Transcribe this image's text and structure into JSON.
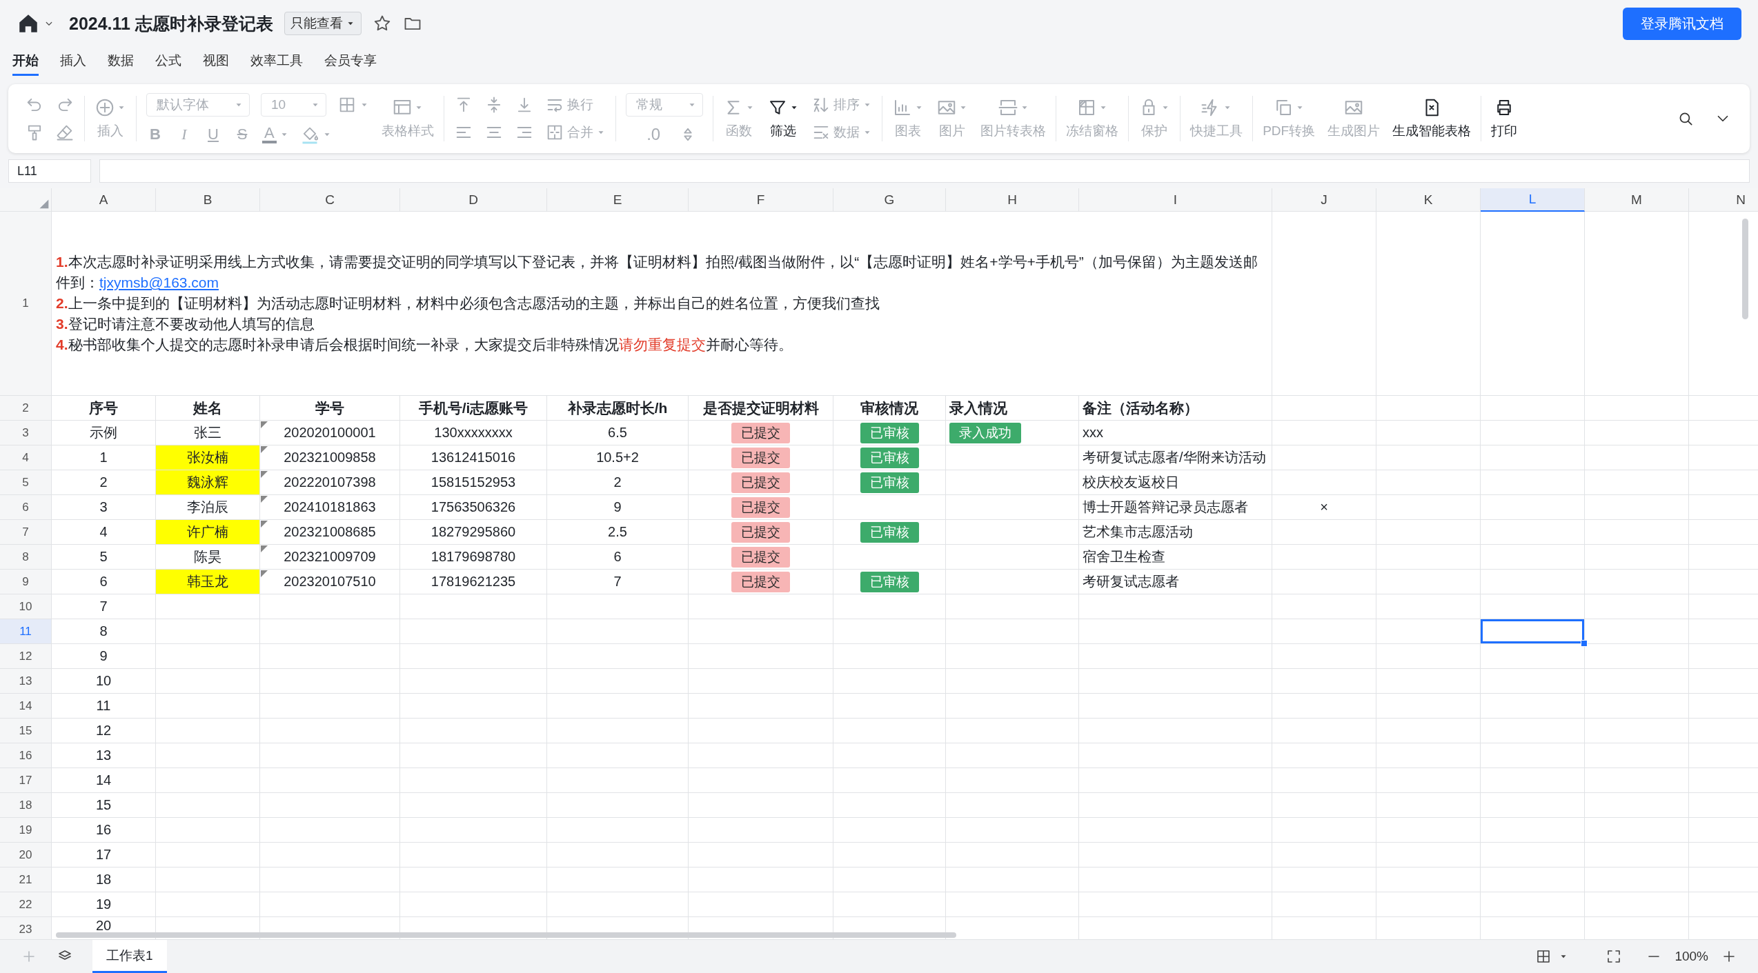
{
  "header": {
    "title": "2024.11 志愿时补录登记表",
    "permission": "只能查看",
    "login_button": "登录腾讯文档"
  },
  "menu_tabs": [
    {
      "label": "开始",
      "selected": true
    },
    {
      "label": "插入",
      "selected": false
    },
    {
      "label": "数据",
      "selected": false
    },
    {
      "label": "公式",
      "selected": false
    },
    {
      "label": "视图",
      "selected": false
    },
    {
      "label": "效率工具",
      "selected": false
    },
    {
      "label": "会员专享",
      "selected": false
    }
  ],
  "toolbar": [
    [
      {
        "kind": "grid",
        "top": [
          {
            "kind": "icon",
            "disabled": true,
            "has_dropdown": false
          },
          {
            "kind": "icon",
            "disabled": true,
            "has_dropdown": false
          }
        ],
        "bottom": [
          {
            "kind": "icon",
            "disabled": true,
            "has_dropdown": false
          },
          {
            "kind": "icon",
            "disabled": true,
            "has_dropdown": false
          }
        ]
      }
    ],
    [
      {
        "kind": "big",
        "label": "插入",
        "disabled": true,
        "has_dropdown": true
      }
    ],
    [
      {
        "kind": "grid",
        "top": [
          {
            "kind": "select",
            "label": "默认字体",
            "disabled": true
          },
          {
            "kind": "select",
            "label": "10",
            "disabled": true
          },
          {
            "kind": "icon",
            "disabled": true,
            "has_dropdown": true
          }
        ],
        "bottom": [
          {
            "kind": "bold",
            "label": "B",
            "disabled": true
          },
          {
            "kind": "italic",
            "label": "I",
            "disabled": true
          },
          {
            "kind": "underline",
            "label": "U",
            "disabled": true
          },
          {
            "kind": "strike",
            "label": "S",
            "disabled": true
          },
          {
            "kind": "color",
            "label": "A",
            "disabled": true,
            "has_dropdown": true
          },
          {
            "kind": "icon",
            "disabled": true,
            "has_dropdown": true
          }
        ]
      },
      {
        "kind": "big",
        "label": "表格样式",
        "disabled": true,
        "has_dropdown": true
      }
    ],
    [
      {
        "kind": "grid",
        "top": [
          {
            "kind": "icon",
            "disabled": true,
            "has_dropdown": false
          },
          {
            "kind": "icon",
            "disabled": true,
            "has_dropdown": false
          },
          {
            "kind": "icon",
            "disabled": true,
            "has_dropdown": false
          },
          {
            "kind": "small",
            "label": "换行",
            "disabled": true,
            "has_dropdown": false
          }
        ],
        "bottom": [
          {
            "kind": "icon",
            "disabled": true,
            "has_dropdown": false
          },
          {
            "kind": "icon",
            "disabled": true,
            "has_dropdown": false
          },
          {
            "kind": "icon",
            "disabled": true,
            "has_dropdown": false
          },
          {
            "kind": "small",
            "label": "合并",
            "disabled": true,
            "has_dropdown": true
          }
        ]
      }
    ],
    [
      {
        "kind": "grid",
        "top": [
          {
            "kind": "select",
            "label": "常规",
            "disabled": true
          }
        ],
        "bottom": [
          {
            "kind": "text",
            "label": ".0",
            "disabled": true
          },
          {
            "kind": "icon",
            "disabled": true,
            "has_dropdown": false
          }
        ]
      }
    ],
    [
      {
        "kind": "big",
        "label": "函数",
        "disabled": true,
        "has_dropdown": true
      },
      {
        "kind": "big",
        "label": "筛选",
        "disabled": false,
        "has_dropdown": true
      },
      {
        "kind": "grid",
        "top": [
          {
            "kind": "small",
            "label": "排序",
            "disabled": true,
            "has_dropdown": true
          }
        ],
        "bottom": [
          {
            "kind": "small",
            "label": "数据",
            "disabled": true,
            "has_dropdown": true
          }
        ]
      }
    ],
    [
      {
        "kind": "big",
        "label": "图表",
        "disabled": true,
        "has_dropdown": true
      },
      {
        "kind": "big",
        "label": "图片",
        "disabled": true,
        "has_dropdown": true
      },
      {
        "kind": "big",
        "label": "图片转表格",
        "disabled": true,
        "has_dropdown": true
      }
    ],
    [
      {
        "kind": "big",
        "label": "冻结窗格",
        "disabled": true,
        "has_dropdown": true
      }
    ],
    [
      {
        "kind": "big",
        "label": "保护",
        "disabled": true,
        "has_dropdown": true
      }
    ],
    [
      {
        "kind": "big",
        "label": "快捷工具",
        "disabled": true,
        "has_dropdown": true
      }
    ],
    [
      {
        "kind": "big",
        "label": "PDF转换",
        "disabled": true,
        "has_dropdown": true
      },
      {
        "kind": "big",
        "label": "生成图片",
        "disabled": true,
        "has_dropdown": false
      },
      {
        "kind": "big",
        "label": "生成智能表格",
        "disabled": false,
        "has_dropdown": false
      }
    ],
    [
      {
        "kind": "big",
        "label": "打印",
        "disabled": false,
        "has_dropdown": false
      }
    ]
  ],
  "name_box": "L11",
  "sheet": {
    "columns": [
      {
        "label": "A",
        "selected": false
      },
      {
        "label": "B",
        "selected": false
      },
      {
        "label": "C",
        "selected": false
      },
      {
        "label": "D",
        "selected": false
      },
      {
        "label": "E",
        "selected": false
      },
      {
        "label": "F",
        "selected": false
      },
      {
        "label": "G",
        "selected": false
      },
      {
        "label": "H",
        "selected": false
      },
      {
        "label": "I",
        "selected": false
      },
      {
        "label": "J",
        "selected": false
      },
      {
        "label": "K",
        "selected": false
      },
      {
        "label": "L",
        "selected": true
      },
      {
        "label": "M",
        "selected": false
      },
      {
        "label": "N",
        "selected": false
      }
    ],
    "rows": [
      {
        "number": "1",
        "kind": "notes",
        "selected": false,
        "notes": [
          [
            {
              "kind": "number",
              "text": "1."
            },
            {
              "kind": "plain",
              "text": "本次志愿时补录证明采用线上方式收集，请需要提交证明的同学填写以下登记表，并将【证明材料】拍照/截图当做附件，以“【志愿时证明】姓名+学号+手机号”（加号保留）为主题发送邮件到："
            },
            {
              "kind": "link",
              "text": "tjxymsb@163.com"
            }
          ],
          [
            {
              "kind": "number",
              "text": "2."
            },
            {
              "kind": "plain",
              "text": "上一条中提到的【证明材料】为活动志愿时证明材料，材料中必须包含志愿活动的主题，并标出自己的姓名位置，方便我们查找"
            }
          ],
          [
            {
              "kind": "number",
              "text": "3."
            },
            {
              "kind": "plain",
              "text": "登记时请注意不要改动他人填写的信息"
            }
          ],
          [
            {
              "kind": "number",
              "text": "4."
            },
            {
              "kind": "plain",
              "text": "秘书部收集个人提交的志愿时补录申请后会根据时间统一补录，大家提交后非特殊情况"
            },
            {
              "kind": "emphasis",
              "text": "请勿重复提交"
            },
            {
              "kind": "plain",
              "text": "并耐心等待。"
            }
          ]
        ]
      },
      {
        "number": "2",
        "kind": "header",
        "selected": false,
        "cells": [
          {
            "kind": "text",
            "text": "序号"
          },
          {
            "kind": "text",
            "text": "姓名"
          },
          {
            "kind": "text",
            "text": "学号"
          },
          {
            "kind": "text",
            "text": "手机号/i志愿账号"
          },
          {
            "kind": "text",
            "text": "补录志愿时长/h"
          },
          {
            "kind": "text",
            "text": "是否提交证明材料"
          },
          {
            "kind": "text",
            "text": "审核情况"
          },
          {
            "kind": "text",
            "text": "录入情况"
          },
          {
            "kind": "text",
            "text": "备注（活动名称）"
          }
        ]
      },
      {
        "number": "3",
        "kind": "data",
        "selected": false,
        "cells": [
          {
            "kind": "text",
            "text": "示例"
          },
          {
            "kind": "text",
            "text": "张三",
            "highlight": false
          },
          {
            "kind": "text",
            "text": "202020100001",
            "comment": true
          },
          {
            "kind": "text",
            "text": "130xxxxxxxx"
          },
          {
            "kind": "text",
            "text": "6.5"
          },
          {
            "kind": "tag",
            "text": "已提交",
            "color": "#f7b5b5"
          },
          {
            "kind": "tag",
            "text": "已审核",
            "color": "#3dab6b"
          },
          {
            "kind": "tag",
            "text": "录入成功",
            "color": "#3dab6b"
          },
          {
            "kind": "text",
            "text": "xxx"
          }
        ]
      },
      {
        "number": "4",
        "kind": "data",
        "selected": false,
        "cells": [
          {
            "kind": "text",
            "text": "1"
          },
          {
            "kind": "text",
            "text": "张汝楠",
            "highlight": true
          },
          {
            "kind": "text",
            "text": "202321009858",
            "comment": true
          },
          {
            "kind": "text",
            "text": "13612415016"
          },
          {
            "kind": "text",
            "text": "10.5+2"
          },
          {
            "kind": "tag",
            "text": "已提交",
            "color": "#f7b5b5"
          },
          {
            "kind": "tag",
            "text": "已审核",
            "color": "#3dab6b"
          },
          {
            "kind": "blank"
          },
          {
            "kind": "text",
            "text": "考研复试志愿者/华附来访活动"
          }
        ]
      },
      {
        "number": "5",
        "kind": "data",
        "selected": false,
        "cells": [
          {
            "kind": "text",
            "text": "2"
          },
          {
            "kind": "text",
            "text": "魏泳辉",
            "highlight": true
          },
          {
            "kind": "text",
            "text": "202220107398",
            "comment": true
          },
          {
            "kind": "text",
            "text": "15815152953"
          },
          {
            "kind": "text",
            "text": "2"
          },
          {
            "kind": "tag",
            "text": "已提交",
            "color": "#f7b5b5"
          },
          {
            "kind": "tag",
            "text": "已审核",
            "color": "#3dab6b"
          },
          {
            "kind": "blank"
          },
          {
            "kind": "text",
            "text": "校庆校友返校日"
          }
        ]
      },
      {
        "number": "6",
        "kind": "data",
        "selected": false,
        "cells": [
          {
            "kind": "text",
            "text": "3"
          },
          {
            "kind": "text",
            "text": "李泊辰",
            "highlight": false
          },
          {
            "kind": "text",
            "text": "202410181863",
            "comment": true
          },
          {
            "kind": "text",
            "text": "17563506326"
          },
          {
            "kind": "text",
            "text": "9"
          },
          {
            "kind": "tag",
            "text": "已提交",
            "color": "#f7b5b5"
          },
          {
            "kind": "blank"
          },
          {
            "kind": "blank"
          },
          {
            "kind": "text",
            "text": "博士开题答辩记录员志愿者"
          },
          {
            "kind": "text",
            "text": "×"
          }
        ]
      },
      {
        "number": "7",
        "kind": "data",
        "selected": false,
        "cells": [
          {
            "kind": "text",
            "text": "4"
          },
          {
            "kind": "text",
            "text": "许广楠",
            "highlight": true
          },
          {
            "kind": "text",
            "text": "202321008685",
            "comment": true
          },
          {
            "kind": "text",
            "text": "18279295860"
          },
          {
            "kind": "text",
            "text": "2.5"
          },
          {
            "kind": "tag",
            "text": "已提交",
            "color": "#f7b5b5"
          },
          {
            "kind": "tag",
            "text": "已审核",
            "color": "#3dab6b"
          },
          {
            "kind": "blank"
          },
          {
            "kind": "text",
            "text": "艺术集市志愿活动"
          }
        ]
      },
      {
        "number": "8",
        "kind": "data",
        "selected": false,
        "cells": [
          {
            "kind": "text",
            "text": "5"
          },
          {
            "kind": "text",
            "text": "陈昊",
            "highlight": false
          },
          {
            "kind": "text",
            "text": "202321009709",
            "comment": true
          },
          {
            "kind": "text",
            "text": "18179698780"
          },
          {
            "kind": "text",
            "text": "6"
          },
          {
            "kind": "tag",
            "text": "已提交",
            "color": "#f7b5b5"
          },
          {
            "kind": "blank"
          },
          {
            "kind": "blank"
          },
          {
            "kind": "text",
            "text": "宿舍卫生检查"
          }
        ]
      },
      {
        "number": "9",
        "kind": "data",
        "selected": false,
        "cells": [
          {
            "kind": "text",
            "text": "6"
          },
          {
            "kind": "text",
            "text": "韩玉龙",
            "highlight": true
          },
          {
            "kind": "text",
            "text": "202320107510",
            "comment": true
          },
          {
            "kind": "text",
            "text": "17819621235"
          },
          {
            "kind": "text",
            "text": "7"
          },
          {
            "kind": "tag",
            "text": "已提交",
            "color": "#f7b5b5"
          },
          {
            "kind": "tag",
            "text": "已审核",
            "color": "#3dab6b"
          },
          {
            "kind": "blank"
          },
          {
            "kind": "text",
            "text": "考研复试志愿者"
          }
        ]
      },
      {
        "number": "10",
        "kind": "data",
        "selected": false,
        "cells": [
          {
            "kind": "text",
            "text": "7"
          }
        ]
      },
      {
        "number": "11",
        "kind": "data",
        "selected": true,
        "cells": [
          {
            "kind": "text",
            "text": "8"
          }
        ]
      },
      {
        "number": "12",
        "kind": "data",
        "selected": false,
        "cells": [
          {
            "kind": "text",
            "text": "9"
          }
        ]
      },
      {
        "number": "13",
        "kind": "data",
        "selected": false,
        "cells": [
          {
            "kind": "text",
            "text": "10"
          }
        ]
      },
      {
        "number": "14",
        "kind": "data",
        "selected": false,
        "cells": [
          {
            "kind": "text",
            "text": "11"
          }
        ]
      },
      {
        "number": "15",
        "kind": "data",
        "selected": false,
        "cells": [
          {
            "kind": "text",
            "text": "12"
          }
        ]
      },
      {
        "number": "16",
        "kind": "data",
        "selected": false,
        "cells": [
          {
            "kind": "text",
            "text": "13"
          }
        ]
      },
      {
        "number": "17",
        "kind": "data",
        "selected": false,
        "cells": [
          {
            "kind": "text",
            "text": "14"
          }
        ]
      },
      {
        "number": "18",
        "kind": "data",
        "selected": false,
        "cells": [
          {
            "kind": "text",
            "text": "15"
          }
        ]
      },
      {
        "number": "19",
        "kind": "data",
        "selected": false,
        "cells": [
          {
            "kind": "text",
            "text": "16"
          }
        ]
      },
      {
        "number": "20",
        "kind": "data",
        "selected": false,
        "cells": [
          {
            "kind": "text",
            "text": "17"
          }
        ]
      },
      {
        "number": "21",
        "kind": "data",
        "selected": false,
        "cells": [
          {
            "kind": "text",
            "text": "18"
          }
        ]
      },
      {
        "number": "22",
        "kind": "data",
        "selected": false,
        "cells": [
          {
            "kind": "text",
            "text": "19"
          }
        ]
      },
      {
        "number": "23",
        "kind": "data",
        "selected": false,
        "cells": [
          {
            "kind": "text",
            "text": "20"
          }
        ]
      }
    ]
  },
  "bottom_bar": {
    "sheet_tabs": [
      {
        "label": "工作表1",
        "selected": true
      }
    ],
    "zoom": "100%"
  }
}
